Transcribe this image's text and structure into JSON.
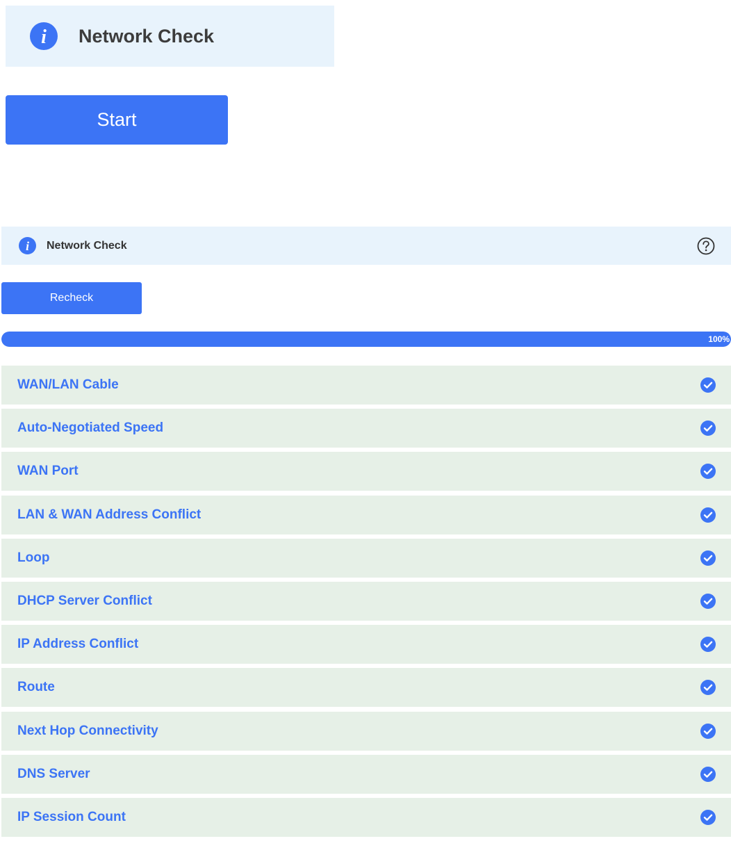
{
  "top_panel": {
    "title": "Network Check",
    "start_label": "Start"
  },
  "result_panel": {
    "title": "Network Check",
    "recheck_label": "Recheck",
    "progress": {
      "value_percent": 100,
      "label": "100%"
    }
  },
  "check_items": [
    {
      "label": "WAN/LAN Cable",
      "status": "pass"
    },
    {
      "label": "Auto-Negotiated Speed",
      "status": "pass"
    },
    {
      "label": "WAN Port",
      "status": "pass"
    },
    {
      "label": "LAN & WAN Address Conflict",
      "status": "pass"
    },
    {
      "label": "Loop",
      "status": "pass"
    },
    {
      "label": "DHCP Server Conflict",
      "status": "pass"
    },
    {
      "label": "IP Address Conflict",
      "status": "pass"
    },
    {
      "label": "Route",
      "status": "pass"
    },
    {
      "label": "Next Hop Connectivity",
      "status": "pass"
    },
    {
      "label": "DNS Server",
      "status": "pass"
    },
    {
      "label": "IP Session Count",
      "status": "pass"
    }
  ],
  "icons": {
    "banner": "info-icon",
    "help": "question-circle-icon",
    "check": "check-circle-icon"
  },
  "colors": {
    "accent": "#3c74f5",
    "banner_bg": "#e8f3fc",
    "item_bg": "#e6f0e7",
    "title_text": "#3c3c3c"
  }
}
